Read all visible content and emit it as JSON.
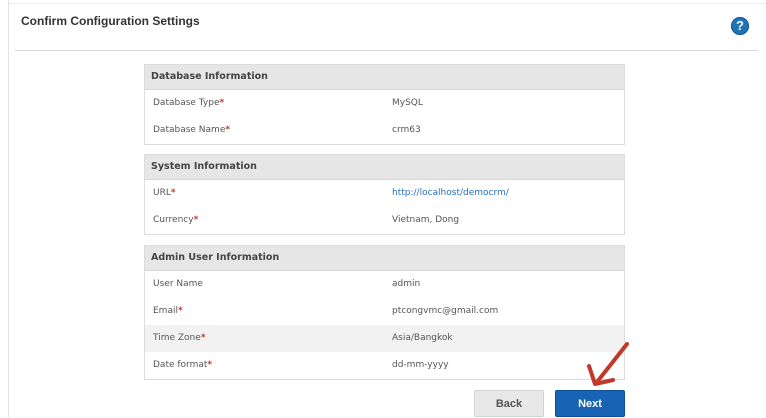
{
  "page": {
    "title": "Confirm Configuration Settings",
    "help_icon": "question-circle-icon",
    "help_glyph": "?"
  },
  "sections": [
    {
      "heading": "Database Information",
      "rows": [
        {
          "label": "Database Type",
          "required": true,
          "value": "MySQL"
        },
        {
          "label": "Database Name",
          "required": true,
          "value": "crm63"
        }
      ]
    },
    {
      "heading": "System Information",
      "rows": [
        {
          "label": "URL",
          "required": true,
          "value": "http://localhost/democrm/"
        },
        {
          "label": "Currency",
          "required": true,
          "value": "Vietnam, Dong"
        }
      ]
    },
    {
      "heading": "Admin User Information",
      "rows": [
        {
          "label": "User Name",
          "required": false,
          "value": "admin"
        },
        {
          "label": "Email",
          "required": true,
          "value": "ptcongvmc@gmail.com"
        },
        {
          "label": "Time Zone",
          "required": true,
          "value": "Asia/Bangkok"
        },
        {
          "label": "Date format",
          "required": true,
          "value": "dd-mm-yyyy"
        }
      ]
    }
  ],
  "required_marker": "*",
  "buttons": {
    "back_label": "Back",
    "next_label": "Next"
  },
  "colors": {
    "primary": "#1863b4",
    "required": "#c9302c",
    "link": "#2a6fbf",
    "annotation_arrow": "#c0392b"
  }
}
